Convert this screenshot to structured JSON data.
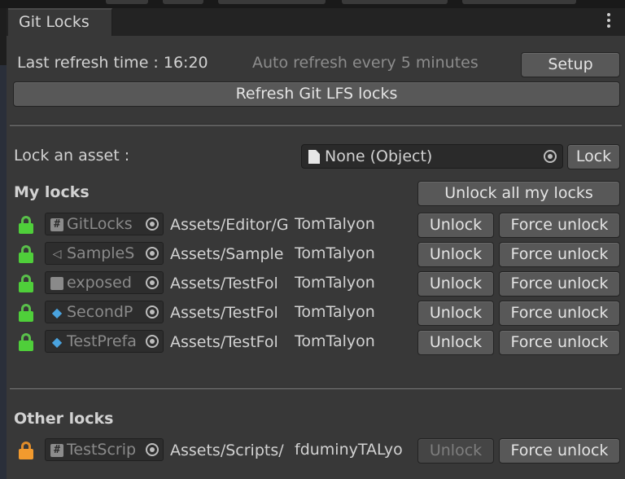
{
  "window": {
    "tab_title": "Git Locks"
  },
  "header": {
    "last_refresh": "Last refresh time : 16:20",
    "auto_refresh": "Auto refresh every 5 minutes",
    "setup_label": "Setup",
    "refresh_label": "Refresh Git LFS locks"
  },
  "lock_asset": {
    "label": "Lock an asset :",
    "field_value": "None (Object)",
    "lock_label": "Lock"
  },
  "my_locks": {
    "title": "My locks",
    "unlock_all_label": "Unlock all my locks",
    "unlock_label": "Unlock",
    "force_unlock_label": "Force unlock",
    "rows": [
      {
        "icon": "csharp-script-icon",
        "name": "GitLocks",
        "path": "Assets/Editor/G",
        "user": "TomTalyon"
      },
      {
        "icon": "scene-icon",
        "name": "SampleS",
        "path": "Assets/Sample",
        "user": "TomTalyon"
      },
      {
        "icon": "folder-icon",
        "name": "exposed",
        "path": "Assets/TestFol",
        "user": "TomTalyon"
      },
      {
        "icon": "prefab-icon",
        "name": "SecondP",
        "path": "Assets/TestFol",
        "user": "TomTalyon"
      },
      {
        "icon": "prefab-icon",
        "name": "TestPrefa",
        "path": "Assets/TestFol",
        "user": "TomTalyon"
      }
    ]
  },
  "other_locks": {
    "title": "Other locks",
    "unlock_label": "Unlock",
    "force_unlock_label": "Force unlock",
    "rows": [
      {
        "icon": "csharp-script-icon",
        "name": "TestScrip",
        "path": "Assets/Scripts/",
        "user": "fduminyTALyo"
      }
    ]
  },
  "colors": {
    "own_lock": "#4fcf3a",
    "other_lock": "#f29a2e",
    "panel": "#383838",
    "button": "#585858"
  }
}
